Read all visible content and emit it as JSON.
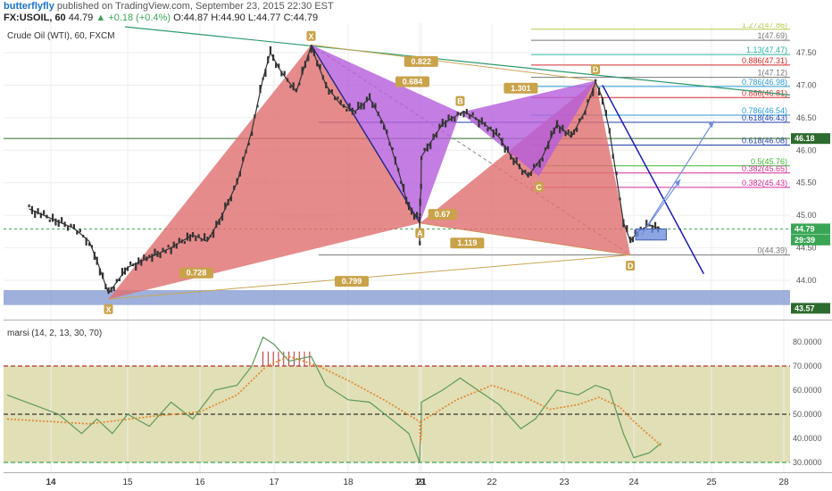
{
  "header": {
    "author": "butterflyfly",
    "published": " published on TradingView.com, September 23, 2015 22:30 EST",
    "symbol": "FX:USOIL, 60",
    "last": "44.79",
    "change": "▲ +0.18 (+0.4%)",
    "ohlc": "O:44.87 H:44.90 L:44.77 C:44.79"
  },
  "chart_data": [
    {
      "type": "line",
      "title": "Crude Oil (WTI), 60, FXCM",
      "watermark_symbol": "USOIL",
      "watermark_name": "Crude Oil (WTI)",
      "ylim": [
        43.4,
        47.9
      ],
      "yticks": [
        "47.50",
        "47.00",
        "46.50",
        "46.00",
        "45.50",
        "45.00",
        "44.50",
        "44.00"
      ],
      "xticks": [
        {
          "day": 14,
          "label": "14"
        },
        {
          "day": 15,
          "label": "15"
        },
        {
          "day": 16,
          "label": "16"
        },
        {
          "day": 17,
          "label": "17"
        },
        {
          "day": 18,
          "label": "18"
        },
        {
          "day": 19,
          "label": "19"
        },
        {
          "day": 21,
          "label": "21"
        },
        {
          "day": 22,
          "label": "22"
        },
        {
          "day": 23,
          "label": "23"
        },
        {
          "day": 24,
          "label": "24"
        },
        {
          "day": 25,
          "label": "25"
        },
        {
          "day": 28,
          "label": "28"
        }
      ],
      "price_path": [
        [
          13.9,
          45.1
        ],
        [
          14.1,
          44.9
        ],
        [
          14.3,
          44.8
        ],
        [
          14.5,
          44.6
        ],
        [
          14.6,
          44.3
        ],
        [
          14.75,
          43.8
        ],
        [
          15.0,
          44.2
        ],
        [
          15.3,
          44.35
        ],
        [
          15.6,
          44.5
        ],
        [
          15.9,
          44.7
        ],
        [
          16.1,
          44.6
        ],
        [
          16.3,
          45.0
        ],
        [
          16.5,
          45.5
        ],
        [
          16.7,
          46.3
        ],
        [
          16.85,
          47.1
        ],
        [
          16.95,
          47.5
        ],
        [
          17.1,
          47.2
        ],
        [
          17.3,
          46.9
        ],
        [
          17.5,
          47.6
        ],
        [
          17.7,
          47.0
        ],
        [
          17.9,
          46.7
        ],
        [
          18.1,
          46.6
        ],
        [
          18.3,
          46.8
        ],
        [
          18.5,
          46.4
        ],
        [
          18.7,
          45.7
        ],
        [
          18.85,
          45.1
        ],
        [
          19.0,
          44.95
        ],
        [
          19.15,
          44.55
        ],
        [
          19.35,
          45.05
        ],
        [
          19.6,
          45.2
        ],
        [
          20.6,
          45.4
        ],
        [
          21.0,
          45.9
        ],
        [
          21.3,
          46.4
        ],
        [
          21.6,
          46.6
        ],
        [
          21.9,
          46.4
        ],
        [
          22.1,
          46.2
        ],
        [
          22.3,
          45.85
        ],
        [
          22.5,
          45.6
        ],
        [
          22.7,
          45.9
        ],
        [
          22.9,
          46.4
        ],
        [
          23.1,
          46.2
        ],
        [
          23.3,
          46.6
        ],
        [
          23.45,
          47.05
        ],
        [
          23.55,
          46.8
        ],
        [
          23.65,
          46.3
        ],
        [
          23.75,
          45.6
        ],
        [
          23.85,
          44.9
        ],
        [
          23.95,
          44.6
        ],
        [
          24.05,
          44.75
        ],
        [
          24.2,
          44.85
        ],
        [
          24.35,
          44.79
        ]
      ],
      "xabcd_outer": {
        "X": [
          14.75,
          43.71
        ],
        "A": [
          17.5,
          47.62
        ],
        "B": [
          19.35,
          44.88
        ],
        "C": [
          23.45,
          47.07
        ],
        "D": [
          23.95,
          44.39
        ]
      },
      "xabcd_inner": {
        "X": [
          17.5,
          47.62
        ],
        "A": [
          19.35,
          44.88
        ],
        "B": [
          21.55,
          46.58
        ],
        "C": [
          22.65,
          45.6
        ],
        "D": [
          23.45,
          47.07
        ]
      },
      "point_labels": [
        {
          "text": "X",
          "day": 14.75,
          "price": 43.55
        },
        {
          "text": "X",
          "day": 17.5,
          "price": 47.75
        },
        {
          "text": "A",
          "day": 19.35,
          "price": 44.72
        },
        {
          "text": "B",
          "day": 21.55,
          "price": 46.75
        },
        {
          "text": "C",
          "day": 22.65,
          "price": 45.43
        },
        {
          "text": "D",
          "day": 23.45,
          "price": 47.24
        },
        {
          "text": "D",
          "day": 23.95,
          "price": 44.22
        }
      ],
      "ratio_labels": [
        {
          "text": "0.684",
          "day": 18.9,
          "price": 47.04
        },
        {
          "text": "0.822",
          "day": 20.8,
          "price": 47.35
        },
        {
          "text": "1.301",
          "day": 22.4,
          "price": 46.94
        },
        {
          "text": "0.67",
          "day": 21.3,
          "price": 45.0
        },
        {
          "text": "1.119",
          "day": 21.65,
          "price": 44.56
        },
        {
          "text": "0.728",
          "day": 15.95,
          "price": 44.1
        },
        {
          "text": "0.799",
          "day": 18.05,
          "price": 43.97
        }
      ],
      "fib_levels": [
        {
          "label": "1.272(47.86)",
          "price": 47.86,
          "color": "#b7c94a"
        },
        {
          "label": "1(47.69)",
          "price": 47.69,
          "color": "#777777"
        },
        {
          "label": "1.13(47.47)",
          "price": 47.47,
          "color": "#2bb3a3"
        },
        {
          "label": "0.886(47.31)",
          "price": 47.31,
          "color": "#d42b2b"
        },
        {
          "label": "1(47.12)",
          "price": 47.12,
          "color": "#777777"
        },
        {
          "label": "0.786(46.98)",
          "price": 46.98,
          "color": "#2a9ad4"
        },
        {
          "label": "0.886(46.81)",
          "price": 46.81,
          "color": "#d42b2b"
        },
        {
          "label": "0.786(46.54)",
          "price": 46.54,
          "color": "#2a9ad4"
        },
        {
          "label": "0.618(46.43)",
          "price": 46.43,
          "color": "#1d3fa8"
        },
        {
          "label": "0.618(46.08)",
          "price": 46.08,
          "color": "#1d3fa8"
        },
        {
          "label": "0.5(45.76)",
          "price": 45.76,
          "color": "#3cb832"
        },
        {
          "label": "0.382(45.65)",
          "price": 45.65,
          "color": "#d42b9a"
        },
        {
          "label": "0.382(45.43)",
          "price": 45.43,
          "color": "#d42b9a"
        },
        {
          "label": "0(44.39)",
          "price": 44.39,
          "color": "#777777"
        }
      ],
      "h_level_line": 46.18,
      "support_zone": [
        43.62,
        43.85
      ],
      "price_tags": [
        {
          "text": "46.18",
          "price": 46.18,
          "color": "#2e6b2e"
        },
        {
          "text": "44.79",
          "price": 44.79,
          "color": "#3aa655"
        },
        {
          "text": "29:39",
          "price": 44.62,
          "color": "#3aa655"
        },
        {
          "text": "43.57",
          "price": 43.57,
          "color": "#2e6b2e"
        }
      ],
      "projection_box": [
        [
          23.95,
          44.79
        ],
        [
          24.35,
          44.62
        ]
      ],
      "projection_arrows": [
        [
          [
            24.1,
            44.7
          ],
          [
            24.6,
            45.55
          ]
        ],
        [
          [
            24.1,
            44.7
          ],
          [
            25.1,
            46.45
          ]
        ]
      ],
      "downtrend": [
        [
          23.55,
          47.0
        ],
        [
          24.9,
          44.1
        ]
      ]
    },
    {
      "type": "line",
      "title": "marsi (14, 2, 13, 30, 70)",
      "ylim": [
        28,
        86
      ],
      "yticks": [
        "80.0000",
        "70.0000",
        "60.0000",
        "50.0000",
        "40.0000",
        "30.0000"
      ],
      "levels": [
        70,
        50,
        30
      ],
      "series": [
        {
          "values": [
            [
              13.8,
              58
            ],
            [
              14.1,
              50
            ],
            [
              14.4,
              42
            ],
            [
              14.6,
              48
            ],
            [
              14.8,
              42
            ],
            [
              15.0,
              50
            ],
            [
              15.3,
              45
            ],
            [
              15.6,
              55
            ],
            [
              15.9,
              48
            ],
            [
              16.2,
              60
            ],
            [
              16.5,
              62
            ],
            [
              16.7,
              70
            ],
            [
              16.85,
              82
            ],
            [
              17.0,
              79
            ],
            [
              17.2,
              72
            ],
            [
              17.5,
              74
            ],
            [
              17.7,
              62
            ],
            [
              18.0,
              56
            ],
            [
              18.3,
              55
            ],
            [
              18.6,
              48
            ],
            [
              18.85,
              42
            ],
            [
              19.05,
              30
            ],
            [
              19.3,
              33
            ],
            [
              19.6,
              38
            ],
            [
              20.0,
              40
            ],
            [
              20.6,
              42
            ],
            [
              21.0,
              55
            ],
            [
              21.3,
              60
            ],
            [
              21.55,
              65
            ],
            [
              21.8,
              60
            ],
            [
              22.1,
              54
            ],
            [
              22.4,
              44
            ],
            [
              22.6,
              48
            ],
            [
              22.9,
              60
            ],
            [
              23.2,
              58
            ],
            [
              23.45,
              62
            ],
            [
              23.65,
              60
            ],
            [
              23.85,
              42
            ],
            [
              24.0,
              32
            ],
            [
              24.2,
              34
            ],
            [
              24.35,
              38
            ]
          ]
        },
        {
          "values": [
            [
              13.8,
              48
            ],
            [
              14.5,
              46
            ],
            [
              15.3,
              49
            ],
            [
              16.0,
              51
            ],
            [
              16.5,
              58
            ],
            [
              16.9,
              70
            ],
            [
              17.2,
              74
            ],
            [
              17.6,
              70
            ],
            [
              18.0,
              64
            ],
            [
              18.5,
              56
            ],
            [
              19.0,
              47
            ],
            [
              19.5,
              41
            ],
            [
              20.0,
              38
            ],
            [
              20.6,
              40
            ],
            [
              21.0,
              47
            ],
            [
              21.5,
              56
            ],
            [
              22.0,
              62
            ],
            [
              22.4,
              58
            ],
            [
              22.8,
              52
            ],
            [
              23.2,
              54
            ],
            [
              23.5,
              57
            ],
            [
              23.8,
              53
            ],
            [
              24.0,
              47
            ],
            [
              24.35,
              37
            ]
          ]
        }
      ]
    }
  ],
  "colors": {
    "outer_fill": "#e06e6e",
    "inner_fill": "#b55cdc",
    "zone_fill": "#7d95cf",
    "oscillator_bg": "#dcd9a8",
    "price": "#333333",
    "osc_line": "#5b9a5b",
    "osc_signal": "#e0832a",
    "projection": "#6f8fdc",
    "downtrend": "#1a1ab8"
  }
}
